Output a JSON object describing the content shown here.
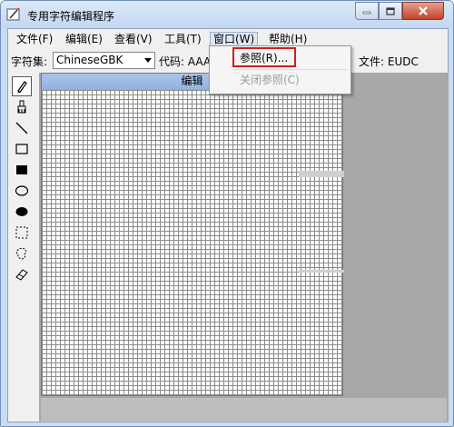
{
  "window": {
    "title": "专用字符编辑程序",
    "colors": {
      "title_bg": "#c8dbf1",
      "close_red": "#c4422a",
      "client_bg": "#f0f0f0",
      "editor_header": "#9dbbe4",
      "highlight_box": "#d21f1f"
    }
  },
  "menubar": {
    "items": [
      {
        "label": "文件(F)"
      },
      {
        "label": "编辑(E)"
      },
      {
        "label": "查看(V)"
      },
      {
        "label": "工具(T)"
      },
      {
        "label": "窗口(W)"
      },
      {
        "label": "帮助(H)"
      }
    ]
  },
  "toolbar": {
    "charset_label": "字符集:",
    "charset_value": "ChineseGBK",
    "code_label": "代码: AAA",
    "file_label": "文件: EUDC"
  },
  "window_menu": {
    "items": [
      {
        "label": "参照(R)...",
        "enabled": true
      },
      {
        "label": "关闭参照(C)",
        "enabled": false
      }
    ]
  },
  "editor": {
    "header": "编辑"
  },
  "tools": [
    {
      "icon": "pencil-icon"
    },
    {
      "icon": "brush-icon"
    },
    {
      "icon": "line-icon"
    },
    {
      "icon": "hollow-rectangle-icon"
    },
    {
      "icon": "filled-rectangle-icon"
    },
    {
      "icon": "hollow-ellipse-icon"
    },
    {
      "icon": "filled-ellipse-icon"
    },
    {
      "icon": "rectangle-select-icon"
    },
    {
      "icon": "freeform-select-icon"
    },
    {
      "icon": "eraser-icon"
    }
  ]
}
